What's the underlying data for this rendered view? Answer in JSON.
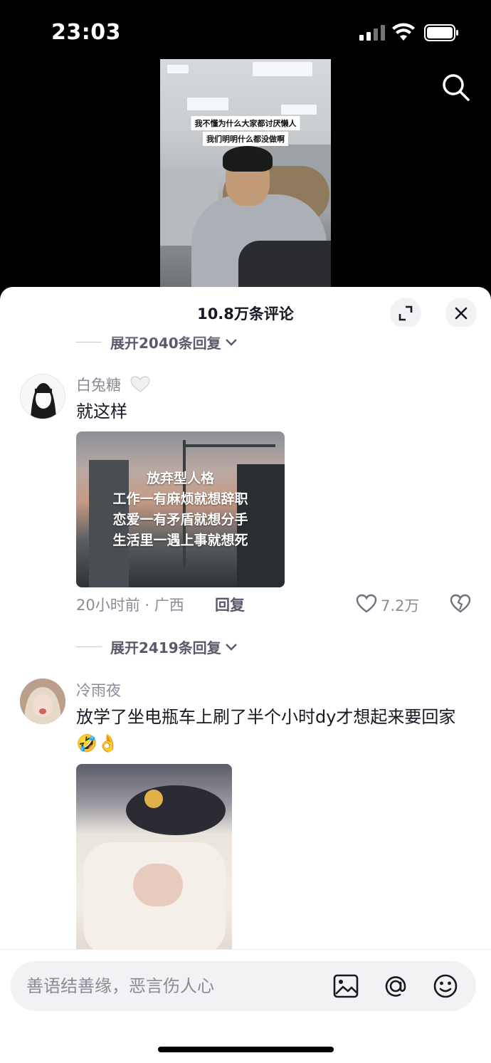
{
  "status_bar": {
    "time": "23:03"
  },
  "video": {
    "caption_line1": "我不懂为什么大家都讨厌懒人",
    "caption_line2": "我们明明什么都没做啊"
  },
  "comments_panel": {
    "title": "10.8万条评论",
    "expand_replies_top": "展开2040条回复",
    "comments": [
      {
        "username": "白兔糖",
        "text": "就这样",
        "image_text": [
          "放弃型人格",
          "工作一有麻烦就想辞职",
          "恋爱一有矛盾就想分手",
          "生活里一遇上事就想死"
        ],
        "time_location": "20小时前 · 广西",
        "reply_label": "回复",
        "likes": "7.2万",
        "expand_replies": "展开2419条回复"
      },
      {
        "username": "冷雨夜",
        "text": "放学了坐电瓶车上刷了半个小时dy才想起来要回家🤣👌"
      }
    ]
  },
  "input_bar": {
    "placeholder": "善语结善缘，恶言伤人心"
  },
  "icons": [
    "search-icon",
    "expand-icon",
    "close-icon",
    "heart-icon",
    "broken-heart-icon",
    "image-icon",
    "at-icon",
    "emoji-icon"
  ]
}
